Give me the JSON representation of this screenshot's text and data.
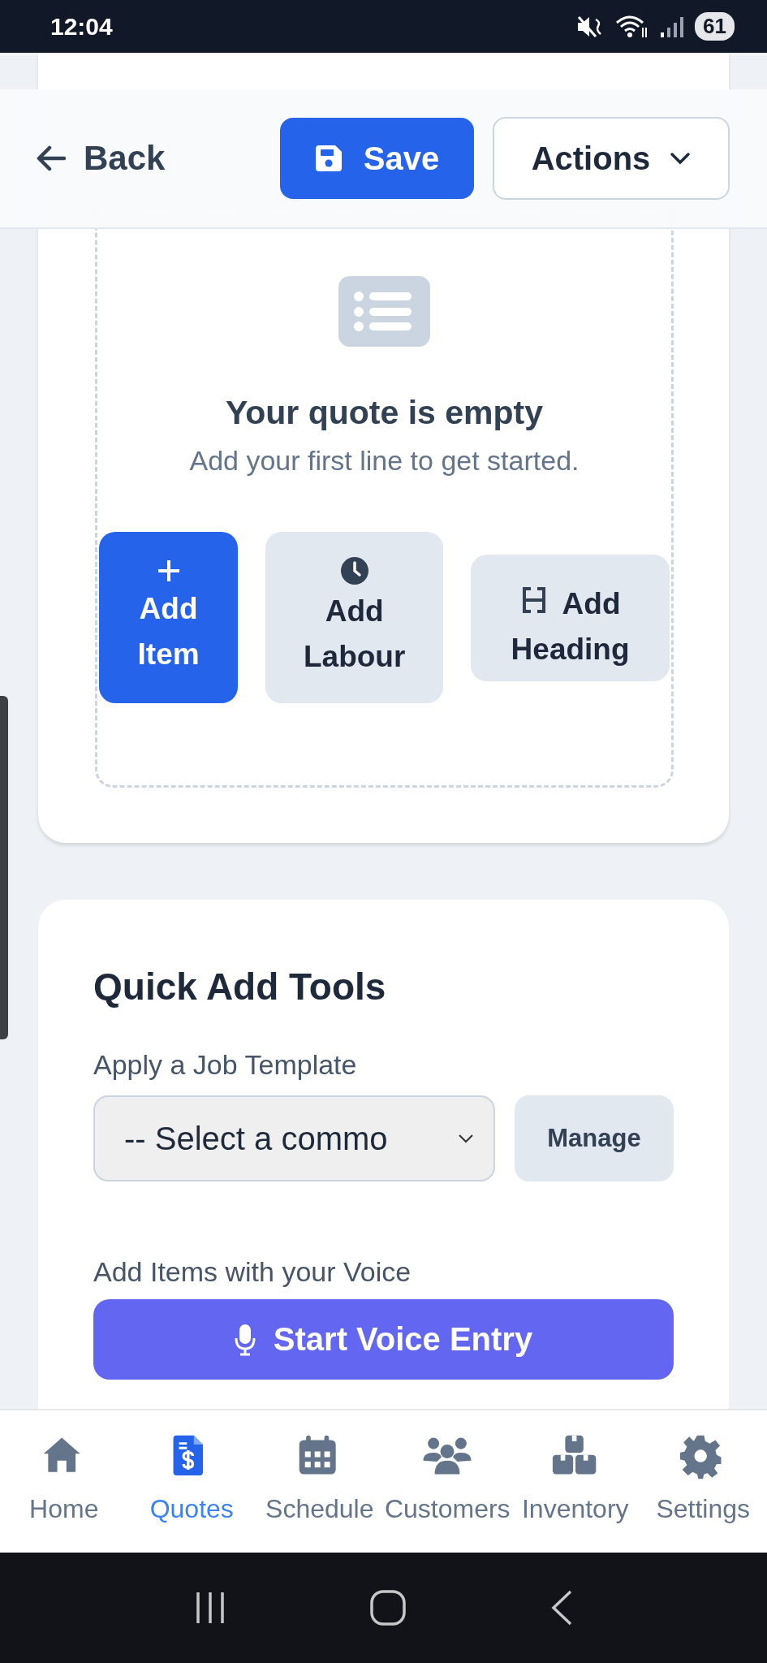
{
  "status_bar": {
    "time": "12:04",
    "battery": "61"
  },
  "toolbar": {
    "back": "Back",
    "save": "Save",
    "actions": "Actions"
  },
  "empty_state": {
    "title": "Your quote is empty",
    "subtitle": "Add your first line to get started."
  },
  "add_buttons": [
    {
      "kind": "item",
      "label": "Add Item"
    },
    {
      "kind": "labour",
      "label": "Add Labour"
    },
    {
      "kind": "heading",
      "label": "Add Heading"
    }
  ],
  "quick_add": {
    "title": "Quick Add Tools",
    "template_label": "Apply a Job Template",
    "template_select": {
      "value": "-- Select a commo"
    },
    "manage": "Manage",
    "voice_label": "Add Items with your Voice",
    "voice_button": "Start Voice Entry"
  },
  "bottom_nav": [
    {
      "label": "Home",
      "selected": false
    },
    {
      "label": "Quotes",
      "selected": true
    },
    {
      "label": "Schedule",
      "selected": false
    },
    {
      "label": "Customers",
      "selected": false
    },
    {
      "label": "Inventory",
      "selected": false
    },
    {
      "label": "Settings",
      "selected": false
    }
  ]
}
